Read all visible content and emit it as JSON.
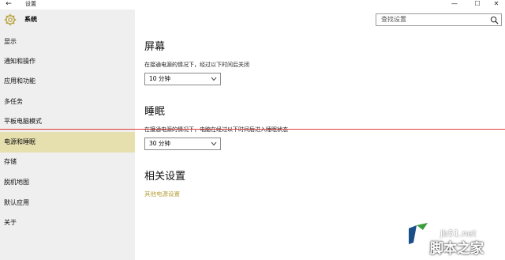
{
  "window": {
    "title": "设置",
    "back_glyph": "←",
    "min_glyph": "—",
    "max_glyph": "☐",
    "close_glyph": "✕"
  },
  "header": {
    "section": "系统"
  },
  "search": {
    "placeholder": "查找设置"
  },
  "sidebar": {
    "items": [
      {
        "label": "显示"
      },
      {
        "label": "通知和操作"
      },
      {
        "label": "应用和功能"
      },
      {
        "label": "多任务"
      },
      {
        "label": "平板电脑模式"
      },
      {
        "label": "电源和睡眠",
        "selected": true
      },
      {
        "label": "存储"
      },
      {
        "label": "脱机地图"
      },
      {
        "label": "默认应用"
      },
      {
        "label": "关于"
      }
    ]
  },
  "screen": {
    "title": "屏幕",
    "description": "在接通电源的情况下，经过以下时间后关闭",
    "value": "10 分钟"
  },
  "sleep": {
    "title": "睡眠",
    "description": "在接通电源的情况下，电脑在经过以下时间后进入睡眠状态",
    "value": "30 分钟"
  },
  "related": {
    "title": "相关设置",
    "link": "其他电源设置"
  },
  "watermark": {
    "site": "jb51.net",
    "brand": "脚本之家"
  },
  "colors": {
    "accent": "#b8a23c",
    "selected_bg": "#e6dfae",
    "sidebar_bg": "#efefef",
    "annotation_line": "#e23b3b"
  }
}
